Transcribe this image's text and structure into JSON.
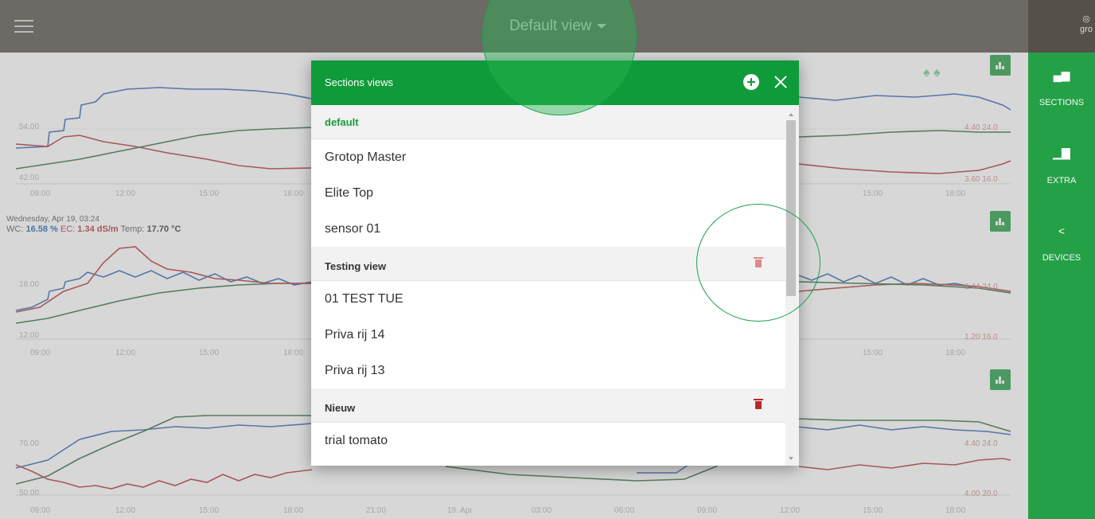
{
  "header": {
    "view_title": "Default view",
    "menu_icon": "hamburger-icon",
    "logo_text": "gro"
  },
  "rightnav": {
    "items": [
      {
        "label": "SECTIONS",
        "icon": "bar-chart-icon"
      },
      {
        "label": "EXTRA",
        "icon": "column-chart-icon"
      },
      {
        "label": "DEVICES",
        "icon": "share-icon"
      }
    ]
  },
  "charts": {
    "panel1": {
      "y_left_top": "54.00",
      "y_left_bottom": "42.00",
      "y_right_top": "4.40  24.0",
      "y_right_bottom": "3.60  16.0"
    },
    "panel2": {
      "date": "Wednesday, Apr 19, 03:24",
      "wc_label": "WC:",
      "wc_value": "16.58 %",
      "ec_label": "EC:",
      "ec_value": "1.34 dS/m",
      "temp_label": "Temp:",
      "temp_value": "17.70 °C",
      "y_left_top": "18.00",
      "y_left_bottom": "12.00",
      "y_right_top": "1.44  24.0",
      "y_right_bottom": "1.20  16.0"
    },
    "panel3": {
      "y_left_top": "70.00",
      "y_left_bottom": "50.00",
      "y_right_top": "4.40  24.0",
      "y_right_bottom": "4.00  20.0"
    },
    "x_ticks": [
      "09:00",
      "12:00",
      "15:00",
      "18:00",
      "21:00",
      "19. Apr",
      "03:00",
      "06:00",
      "09:00",
      "12:00",
      "15:00",
      "18:00"
    ],
    "colors": {
      "wc": "#2f63b5",
      "ec": "#b23232",
      "temp": "#2e6b3a"
    }
  },
  "modal": {
    "title": "Sections views",
    "groups": [
      {
        "name": "default",
        "active": true,
        "deletable": false,
        "items": [
          "Grotop Master",
          "Elite Top",
          "sensor 01"
        ]
      },
      {
        "name": "Testing view",
        "active": false,
        "deletable": true,
        "items": [
          "01 TEST TUE",
          "Priva rij 14",
          "Priva rij 13"
        ]
      },
      {
        "name": "Nieuw",
        "active": false,
        "deletable": true,
        "items": [
          "trial tomato"
        ]
      }
    ]
  },
  "theme": {
    "accent": "#0f9b3a",
    "topbar": "#555049",
    "sidebar": "#24a047"
  }
}
